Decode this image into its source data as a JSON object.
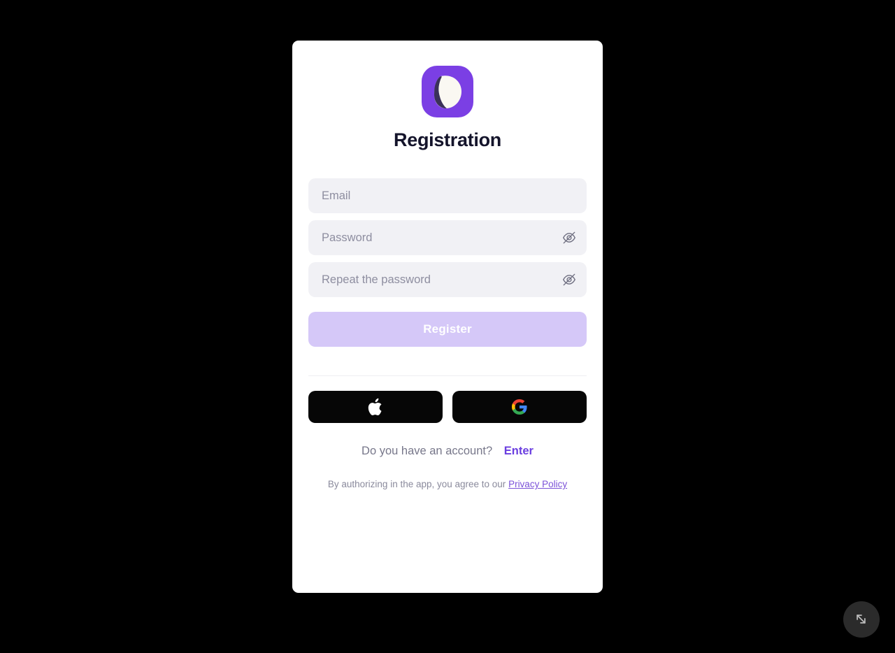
{
  "app": {
    "background_color": "#000000",
    "card_background": "#ffffff",
    "accent_color": "#7B3FE4",
    "link_color": "#6B3FE0"
  },
  "logo": {
    "name": "app-logo",
    "tile_color": "#7B3FE4",
    "leaf_light_color": "#FAF8F2",
    "leaf_dark_color": "#3B3159"
  },
  "title": "Registration",
  "form": {
    "email": {
      "placeholder": "Email",
      "value": ""
    },
    "password": {
      "placeholder": "Password",
      "value": "",
      "toggle_icon": "eye-off-icon"
    },
    "repeat_password": {
      "placeholder": "Repeat the password",
      "value": "",
      "toggle_icon": "eye-off-icon"
    },
    "submit_label": "Register",
    "submit_state": "disabled",
    "submit_color": "#D5C8F8"
  },
  "social": {
    "apple": {
      "icon": "apple-icon",
      "label": ""
    },
    "google": {
      "icon": "google-icon",
      "label": ""
    }
  },
  "account": {
    "question": "Do you have an account?",
    "link_label": "Enter"
  },
  "terms": {
    "prefix": "By authorizing in the app, you agree to our ",
    "link_label": "Privacy Policy"
  },
  "fab": {
    "icon": "expand-diagonal-icon",
    "color": "#2B2B2B"
  }
}
